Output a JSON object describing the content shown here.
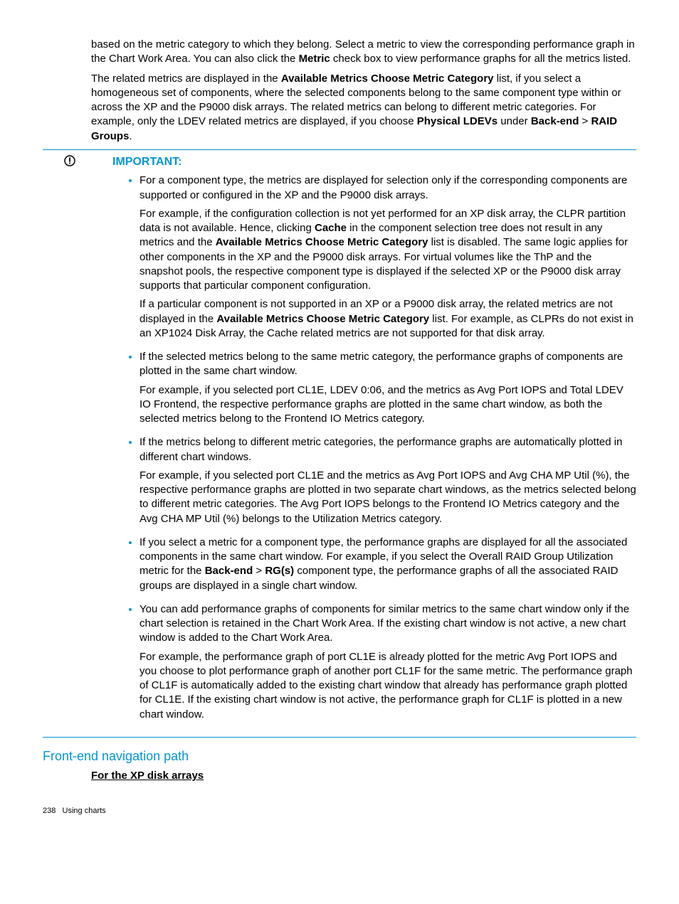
{
  "intro": {
    "p1_a": "based on the metric category to which they belong. Select a metric to view the corresponding performance graph in the Chart Work Area. You can also click the ",
    "p1_b_metric": "Metric",
    "p1_c": " check box to view performance graphs for all the metrics listed.",
    "p2_a": "The related metrics are displayed in the ",
    "p2_b_amcmc": "Available Metrics Choose Metric Category",
    "p2_c": " list, if you select a homogeneous set of components, where the selected components belong to the same component type within or across the XP and the P9000 disk arrays. The related metrics can belong to different metric categories. For example, only the LDEV related metrics are displayed, if you choose ",
    "p2_d_physical": "Physical LDEVs",
    "p2_e": " under ",
    "p2_f_backend": "Back-end",
    "p2_g": " > ",
    "p2_h_raid": "RAID Groups",
    "p2_i": "."
  },
  "important": {
    "heading": "IMPORTANT:",
    "b1_p1": "For a component type, the metrics are displayed for selection only if the corresponding components are supported or configured in the XP and the P9000 disk arrays.",
    "b1_p2_a": "For example, if the configuration collection is not yet performed for an XP disk array, the CLPR partition data is not available. Hence, clicking ",
    "b1_p2_b_cache": "Cache",
    "b1_p2_c": " in the component selection tree does not result in any metrics and the ",
    "b1_p2_d_amcmc": "Available Metrics Choose Metric Category",
    "b1_p2_e": " list is disabled. The same logic applies for other components in the XP and the P9000 disk arrays. For virtual volumes like the ThP and the snapshot pools, the respective component type is displayed if the selected XP or the P9000 disk array supports that particular component configuration.",
    "b1_p3_a": "If a particular component is not supported in an XP or a P9000 disk array, the related metrics are not displayed in the ",
    "b1_p3_b_amcmc": "Available Metrics Choose Metric Category",
    "b1_p3_c": " list. For example, as CLPRs do not exist in an XP1024 Disk Array, the Cache related metrics are not supported for that disk array.",
    "b2_p1": "If the selected metrics belong to the same metric category, the performance graphs of components are plotted in the same chart window.",
    "b2_p2": "For example, if you selected port CL1E, LDEV 0:06, and the metrics as Avg Port IOPS and Total LDEV IO  Frontend, the respective performance graphs are plotted in the same chart window, as both the selected metrics belong to the Frontend IO Metrics category.",
    "b3_p1": "If the metrics belong to different metric categories, the performance graphs are automatically plotted in different chart windows.",
    "b3_p2": "For example, if you selected port CL1E and the metrics as Avg Port IOPS and Avg CHA MP Util (%), the respective performance graphs are plotted in two separate chart windows, as the metrics selected belong to different metric categories. The Avg Port IOPS belongs to the Frontend IO Metrics category and the Avg CHA MP Util (%) belongs to the Utilization Metrics category.",
    "b4_p1_a": "If you select a metric for a component type, the performance graphs are displayed for all the associated components in the same chart window. For example, if you select the Overall RAID Group Utilization metric for the ",
    "b4_p1_b_backend": "Back-end",
    "b4_p1_c": " > ",
    "b4_p1_d_rgs": "RG(s)",
    "b4_p1_e": " component type, the performance graphs of all the associated RAID groups are displayed in a single chart window.",
    "b5_p1": "You can add performance graphs of components for similar metrics to the same chart window only if the chart selection is retained in the Chart Work Area. If the existing chart window is not active, a new chart window is added to the Chart Work Area.",
    "b5_p2": "For example, the performance graph of port CL1E is already plotted for the metric Avg Port IOPS and you choose to plot performance graph of another port CL1F for the same metric. The performance graph of CL1F is automatically added to the existing chart window that already has performance graph plotted for CL1E. If the existing chart window is not active, the performance graph for CL1F is plotted in a new chart window."
  },
  "section": {
    "heading": "Front-end navigation path",
    "subhead": "For the XP disk arrays"
  },
  "footer": {
    "page": "238",
    "title": "Using charts"
  }
}
